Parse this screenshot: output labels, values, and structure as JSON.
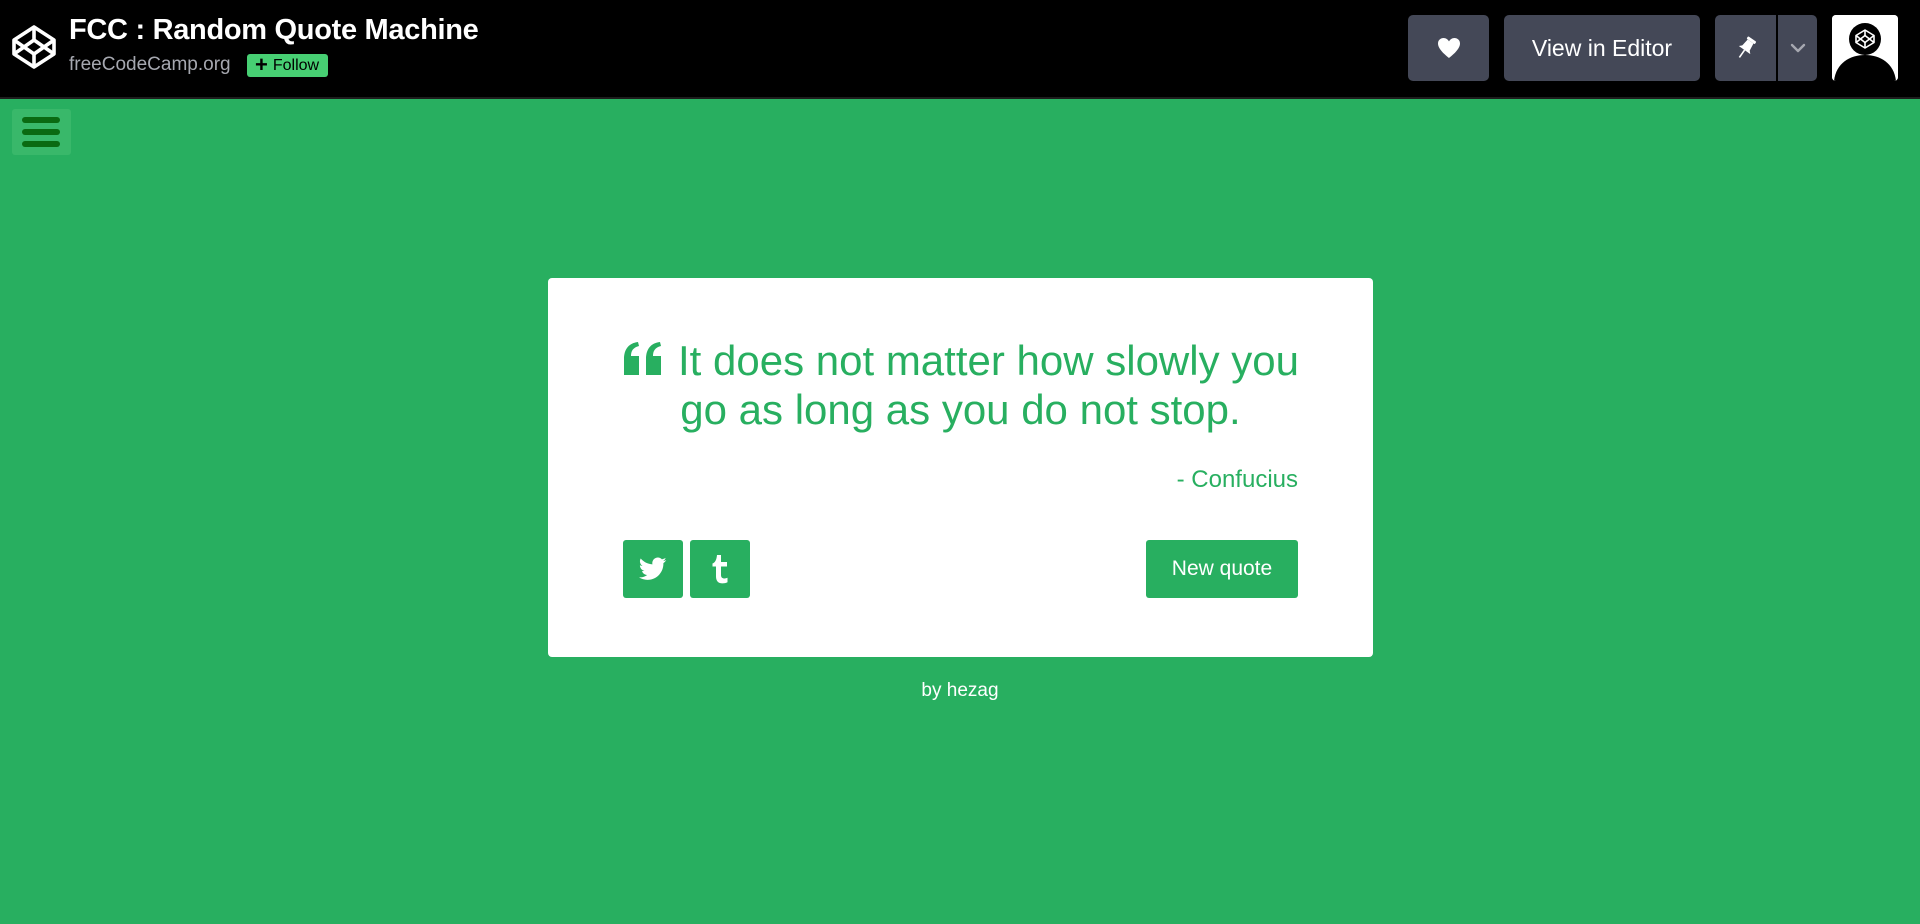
{
  "header": {
    "title": "FCC : Random Quote Machine",
    "author": "freeCodeCamp.org",
    "follow_label": "Follow",
    "heart_icon": "heart-icon",
    "view_in_editor_label": "View in Editor",
    "pin_icon": "pin-icon",
    "chevron_icon": "chevron-down-icon",
    "logo_icon": "codepen-logo-icon"
  },
  "menu": {
    "icon": "hamburger-icon"
  },
  "quote": {
    "icon": "quote-left-icon",
    "text": "It does not matter how slowly you go as long as you do not stop.",
    "author": "- Confucius",
    "twitter_icon": "twitter-icon",
    "tumblr_icon": "tumblr-icon",
    "new_quote_label": "New quote"
  },
  "footer": {
    "by_prefix": "by",
    "by_name": "hezag"
  },
  "colors": {
    "accent": "#28af60",
    "topbar": "#000000",
    "button": "#444857",
    "follow": "#47cf73"
  }
}
